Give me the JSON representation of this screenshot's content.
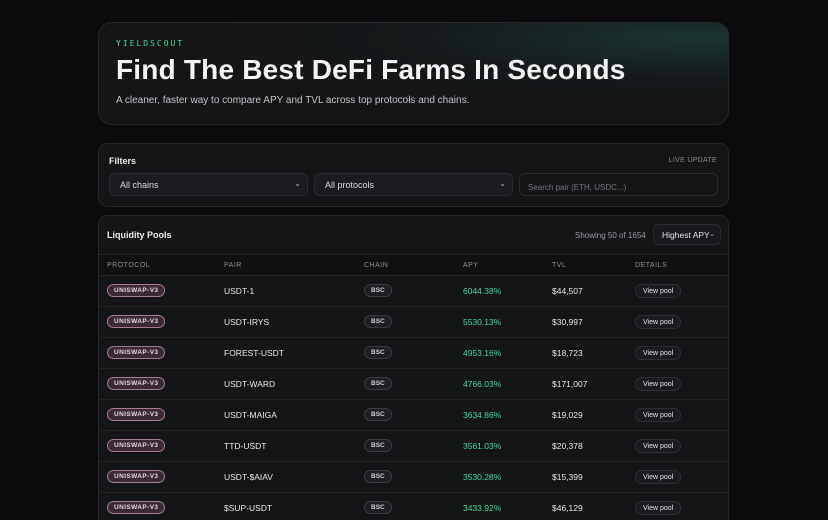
{
  "hero": {
    "brand": "YIELDSCOUT",
    "title": "Find The Best DeFi Farms In Seconds",
    "subtitle": "A cleaner, faster way to compare APY and TVL across top protocols and chains."
  },
  "filters": {
    "title": "Filters",
    "live_label": "LIVE UPDATE",
    "chain_select": "All chains",
    "protocol_select": "All protocols",
    "search_placeholder": "Search pair (ETH, USDC...)"
  },
  "pools": {
    "title": "Liquidity Pools",
    "showing": "Showing 50 of 1654",
    "sort": "Highest APY",
    "columns": [
      "PROTOCOL",
      "PAIR",
      "CHAIN",
      "APY",
      "TVL",
      "DETAILS"
    ],
    "rows": [
      {
        "protocol": "UNISWAP-V3",
        "pair": "USDT-1",
        "chain": "BSC",
        "apy": "6044.38%",
        "tvl": "$44,507",
        "action": "View pool"
      },
      {
        "protocol": "UNISWAP-V3",
        "pair": "USDT-IRYS",
        "chain": "BSC",
        "apy": "5530.13%",
        "tvl": "$30,997",
        "action": "View pool"
      },
      {
        "protocol": "UNISWAP-V3",
        "pair": "FOREST-USDT",
        "chain": "BSC",
        "apy": "4953.16%",
        "tvl": "$18,723",
        "action": "View pool"
      },
      {
        "protocol": "UNISWAP-V3",
        "pair": "USDT-WARD",
        "chain": "BSC",
        "apy": "4766.03%",
        "tvl": "$171,007",
        "action": "View pool"
      },
      {
        "protocol": "UNISWAP-V3",
        "pair": "USDT-MAIGA",
        "chain": "BSC",
        "apy": "3634.86%",
        "tvl": "$19,029",
        "action": "View pool"
      },
      {
        "protocol": "UNISWAP-V3",
        "pair": "TTD-USDT",
        "chain": "BSC",
        "apy": "3561.03%",
        "tvl": "$20,378",
        "action": "View pool"
      },
      {
        "protocol": "UNISWAP-V3",
        "pair": "USDT-$AIAV",
        "chain": "BSC",
        "apy": "3530.28%",
        "tvl": "$15,399",
        "action": "View pool"
      },
      {
        "protocol": "UNISWAP-V3",
        "pair": "$SUP-USDT",
        "chain": "BSC",
        "apy": "3433.92%",
        "tvl": "$46,129",
        "action": "View pool"
      }
    ]
  },
  "colors": {
    "accent": "#3fd6a6",
    "background": "#0b0b0d",
    "panel": "#141517",
    "protocol_badge": "#3a2a34"
  },
  "icons": {
    "select_chevron": "chevron-down-icon"
  }
}
